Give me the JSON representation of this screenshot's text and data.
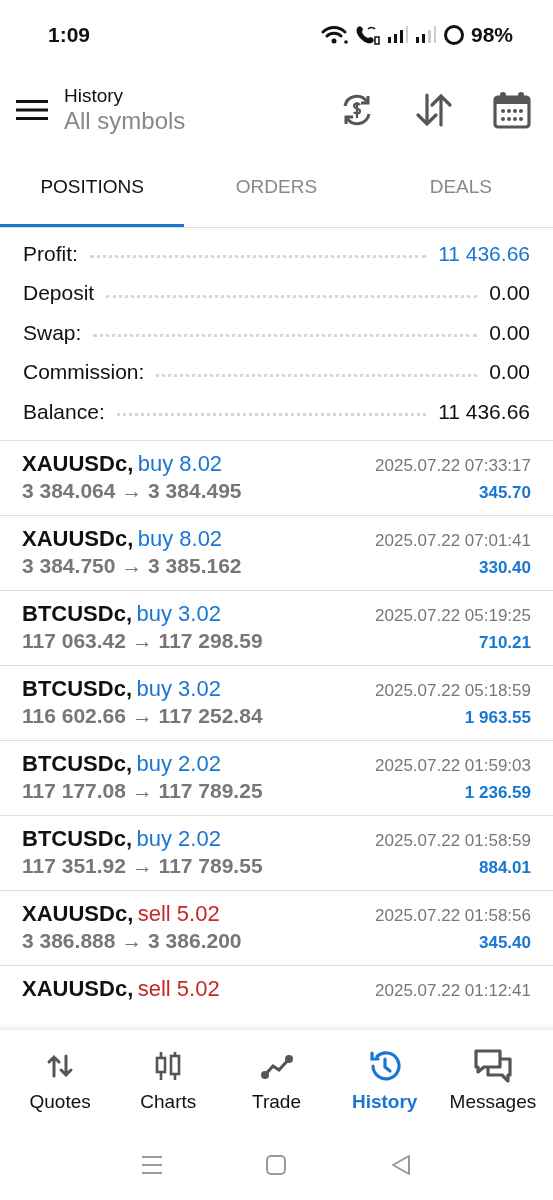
{
  "status_bar": {
    "time": "1:09",
    "battery": "98%"
  },
  "header": {
    "title": "History",
    "subtitle": "All symbols"
  },
  "tabs": [
    {
      "label": "POSITIONS",
      "selected": true
    },
    {
      "label": "ORDERS",
      "selected": false
    },
    {
      "label": "DEALS",
      "selected": false
    }
  ],
  "summary": [
    {
      "label": "Profit:",
      "value": "11 436.66",
      "accent": true
    },
    {
      "label": "Deposit",
      "value": "0.00",
      "accent": false
    },
    {
      "label": "Swap:",
      "value": "0.00",
      "accent": false
    },
    {
      "label": "Commission:",
      "value": "0.00",
      "accent": false
    },
    {
      "label": "Balance:",
      "value": "11 436.66",
      "accent": false
    }
  ],
  "positions": [
    {
      "symbol": "XAUUSDc,",
      "deal": "buy 8.02",
      "kind": "buy",
      "time": "2025.07.22 07:33:17",
      "prices": "3 384.064 → 3 384.495",
      "profit": "345.70"
    },
    {
      "symbol": "XAUUSDc,",
      "deal": "buy 8.02",
      "kind": "buy",
      "time": "2025.07.22 07:01:41",
      "prices": "3 384.750 → 3 385.162",
      "profit": "330.40"
    },
    {
      "symbol": "BTCUSDc,",
      "deal": "buy 3.02",
      "kind": "buy",
      "time": "2025.07.22 05:19:25",
      "prices": "117 063.42 → 117 298.59",
      "profit": "710.21"
    },
    {
      "symbol": "BTCUSDc,",
      "deal": "buy 3.02",
      "kind": "buy",
      "time": "2025.07.22 05:18:59",
      "prices": "116 602.66 → 117 252.84",
      "profit": "1 963.55"
    },
    {
      "symbol": "BTCUSDc,",
      "deal": "buy 2.02",
      "kind": "buy",
      "time": "2025.07.22 01:59:03",
      "prices": "117 177.08 → 117 789.25",
      "profit": "1 236.59"
    },
    {
      "symbol": "BTCUSDc,",
      "deal": "buy 2.02",
      "kind": "buy",
      "time": "2025.07.22 01:58:59",
      "prices": "117 351.92 → 117 789.55",
      "profit": "884.01"
    },
    {
      "symbol": "XAUUSDc,",
      "deal": "sell 5.02",
      "kind": "sell",
      "time": "2025.07.22 01:58:56",
      "prices": "3 386.888 → 3 386.200",
      "profit": "345.40"
    },
    {
      "symbol": "XAUUSDc,",
      "deal": "sell 5.02",
      "kind": "sell",
      "time": "2025.07.22 01:12:41"
    }
  ],
  "bottom_nav": [
    {
      "label": "Quotes",
      "selected": false
    },
    {
      "label": "Charts",
      "selected": false
    },
    {
      "label": "Trade",
      "selected": false
    },
    {
      "label": "History",
      "selected": true
    },
    {
      "label": "Messages",
      "selected": false
    }
  ]
}
